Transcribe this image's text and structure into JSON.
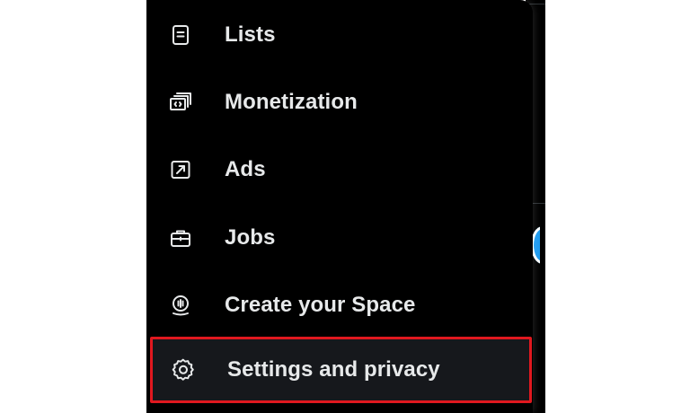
{
  "menu": {
    "items": [
      {
        "label": "Lists",
        "icon": "list-icon"
      },
      {
        "label": "Monetization",
        "icon": "money-icon"
      },
      {
        "label": "Ads",
        "icon": "ads-icon"
      },
      {
        "label": "Jobs",
        "icon": "briefcase-icon"
      },
      {
        "label": "Create your Space",
        "icon": "microphone-icon"
      },
      {
        "label": "Settings and privacy",
        "icon": "gear-icon",
        "highlighted": true
      }
    ]
  },
  "colors": {
    "menu_background": "#000000",
    "text": "#e7e9ea",
    "highlight_background": "#16181c",
    "highlight_border": "#e0181f",
    "accent": "#1d9bf0"
  }
}
